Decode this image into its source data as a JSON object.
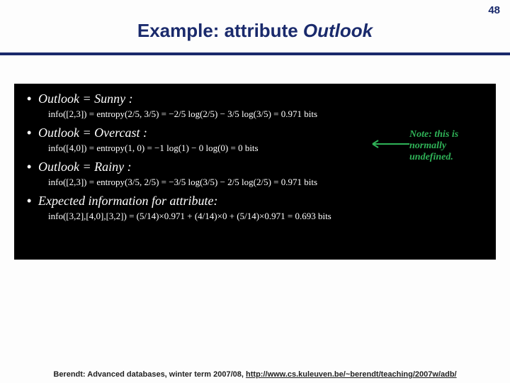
{
  "page_number": "48",
  "title_prefix": "Example: attribute ",
  "title_emph": "Outlook",
  "bullets": {
    "sunny_head": "Outlook = Sunny :",
    "sunny_eq": "info([2,3]) = entropy(2/5, 3/5) = −2/5 log(2/5) − 3/5 log(3/5) = 0.971 bits",
    "overcast_head": "Outlook = Overcast :",
    "overcast_eq": "info([4,0]) = entropy(1, 0) = −1 log(1) − 0 log(0) = 0 bits",
    "rainy_head": "Outlook = Rainy :",
    "rainy_eq": "info([2,3]) = entropy(3/5, 2/5) = −3/5 log(3/5) − 2/5 log(2/5) = 0.971 bits",
    "expected_head": "Expected information for attribute:",
    "expected_eq": "info([3,2],[4,0],[3,2]) = (5/14)×0.971 + (4/14)×0 + (5/14)×0.971 = 0.693 bits"
  },
  "note_text": "Note: this is normally undefined.",
  "footer_prefix": "Berendt: Advanced databases, winter term 2007/08, ",
  "footer_url": "http://www.cs.kuleuven.be/~berendt/teaching/2007w/adb/"
}
